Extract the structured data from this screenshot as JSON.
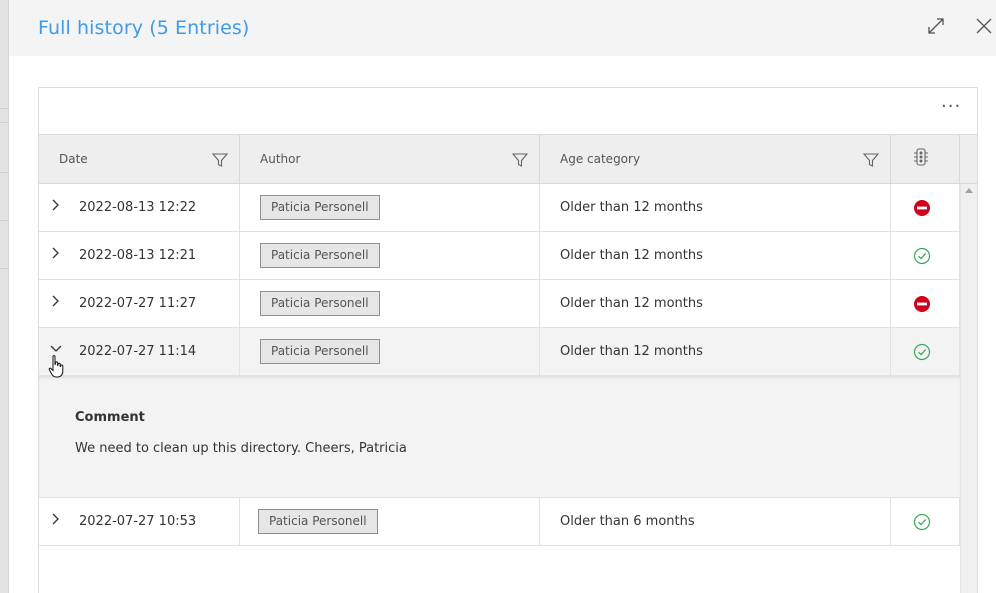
{
  "dialog": {
    "title": "Full history (5 Entries)",
    "accent_color": "#3d9be9"
  },
  "toolbar": {
    "more_label": "···"
  },
  "columns": {
    "date": "Date",
    "author": "Author",
    "age": "Age category",
    "status_icon": "traffic-light-icon"
  },
  "rows": [
    {
      "date": "2022-08-13 12:22",
      "author": "Paticia Personell",
      "age": "Older than 12 months",
      "status": "blocked",
      "expanded": false
    },
    {
      "date": "2022-08-13 12:21",
      "author": "Paticia Personell",
      "age": "Older than 12 months",
      "status": "ok",
      "expanded": false
    },
    {
      "date": "2022-07-27 11:27",
      "author": "Paticia Personell",
      "age": "Older than 12 months",
      "status": "blocked",
      "expanded": false
    },
    {
      "date": "2022-07-27 11:14",
      "author": "Paticia Personell",
      "age": "Older than 12 months",
      "status": "ok",
      "expanded": true
    },
    {
      "date": "2022-07-27 10:53",
      "author": "Paticia Personell",
      "age": "Older than 6 months",
      "status": "ok",
      "expanded": false
    }
  ],
  "detail": {
    "label": "Comment",
    "text": "We need to clean up this directory. Cheers, Patricia"
  },
  "colors": {
    "blocked": "#d0021b",
    "ok": "#3aa85a"
  }
}
